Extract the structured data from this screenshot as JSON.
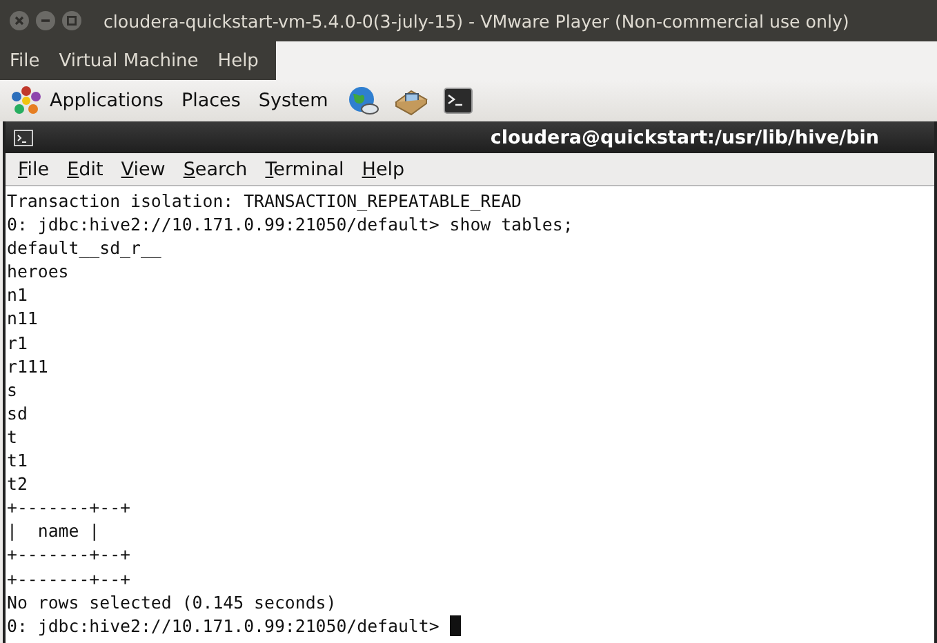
{
  "window": {
    "title": "cloudera-quickstart-vm-5.4.0-0(3-july-15) - VMware Player (Non-commercial use only)"
  },
  "player_menu": [
    "File",
    "Virtual Machine",
    "Help"
  ],
  "panel": {
    "menus": [
      "Applications",
      "Places",
      "System"
    ]
  },
  "terminal": {
    "title": "cloudera@quickstart:/usr/lib/hive/bin",
    "menu": [
      "File",
      "Edit",
      "View",
      "Search",
      "Terminal",
      "Help"
    ],
    "lines": [
      "Transaction isolation: TRANSACTION_REPEATABLE_READ",
      "0: jdbc:hive2://10.171.0.99:21050/default> show tables;",
      "default__sd_r__",
      "heroes",
      "n1",
      "n11",
      "r1",
      "r111",
      "s",
      "sd",
      "t",
      "t1",
      "t2",
      "+-------+--+",
      "|  name |",
      "+-------+--+",
      "+-------+--+",
      "No rows selected (0.145 seconds)",
      "0: jdbc:hive2://10.171.0.99:21050/default> "
    ]
  }
}
